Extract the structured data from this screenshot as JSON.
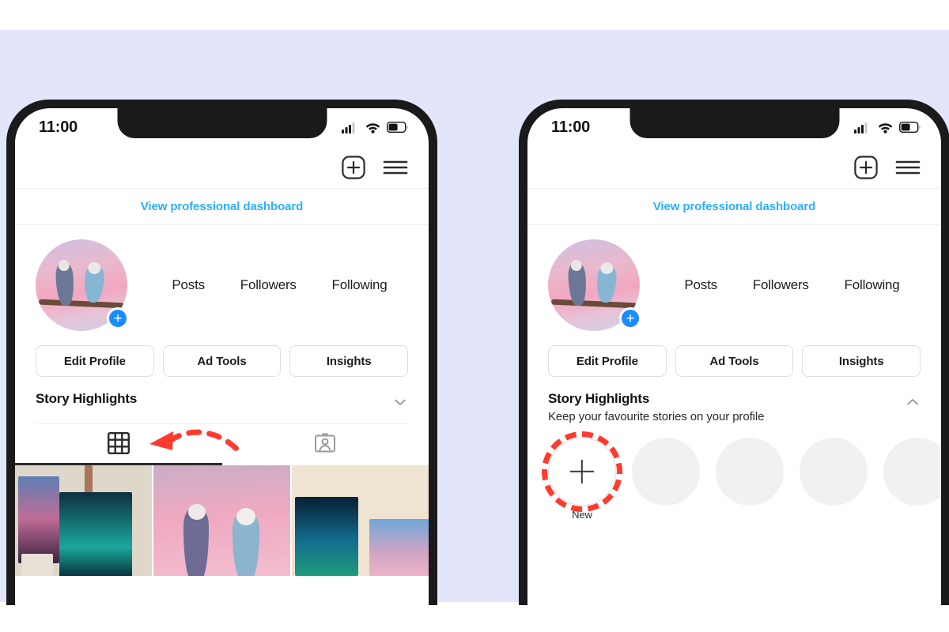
{
  "background": {
    "band_color": "#e3e6fb",
    "page_color": "#ffffff"
  },
  "accent_colors": {
    "link_blue": "#2daeff",
    "annotation_red": "#ff3b30",
    "avatar_badge_blue": "#1a8cff",
    "placeholder_gray": "#f1f1f1"
  },
  "status_bar": {
    "time": "11:00",
    "icons": [
      "cellular-signal-icon",
      "wifi-icon",
      "battery-icon"
    ]
  },
  "top_bar": {
    "add_label": "plus-box-icon",
    "menu_label": "hamburger-menu-icon"
  },
  "professional_dashboard": {
    "link_label": "View professional dashboard"
  },
  "profile": {
    "avatar_alt": "profile-photo-two-budgies",
    "add_story_label": "+",
    "stats": [
      {
        "label": "Posts"
      },
      {
        "label": "Followers"
      },
      {
        "label": "Following"
      }
    ]
  },
  "action_buttons": [
    {
      "label": "Edit Profile"
    },
    {
      "label": "Ad Tools"
    },
    {
      "label": "Insights"
    }
  ],
  "phone_left": {
    "story_highlights": {
      "title": "Story Highlights",
      "subtitle": "",
      "expanded": false,
      "chevron": "chevron-down-icon"
    },
    "tabs": [
      {
        "icon": "grid-icon",
        "active": true
      },
      {
        "icon": "tagged-person-icon",
        "active": false
      }
    ],
    "annotation": {
      "type": "curved-dashed-arrow",
      "color": "#ff3b30",
      "points_to": "Story Highlights"
    }
  },
  "phone_right": {
    "story_highlights": {
      "title": "Story Highlights",
      "subtitle": "Keep your favourite stories on your profile",
      "expanded": true,
      "chevron": "chevron-up-icon"
    },
    "highlight_circles": [
      {
        "type": "new",
        "label": "New",
        "highlighted": true
      },
      {
        "type": "placeholder",
        "label": ""
      },
      {
        "type": "placeholder",
        "label": ""
      },
      {
        "type": "placeholder",
        "label": ""
      },
      {
        "type": "placeholder",
        "label": ""
      }
    ]
  }
}
